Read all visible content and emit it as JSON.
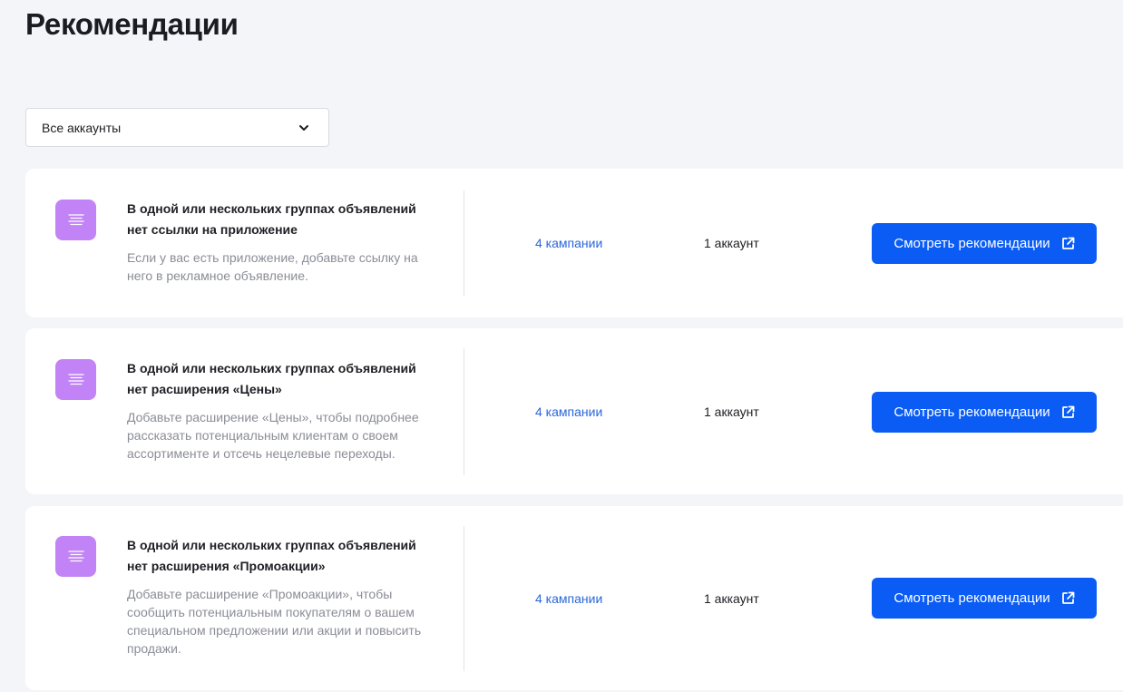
{
  "page": {
    "title": "Рекомендации"
  },
  "filter": {
    "selected": "Все аккаунты"
  },
  "recommendations": [
    {
      "title": "В одной или нескольких группах объявлений нет ссылки на приложение",
      "description": "Если у вас есть приложение, добавьте ссылку на него в рекламное объявление.",
      "campaigns": "4 кампании",
      "accounts": "1 аккаунт",
      "action_label": "Смотреть рекомендации"
    },
    {
      "title": "В одной или нескольких группах объявлений нет расширения «Цены»",
      "description": "Добавьте расширение «Цены», чтобы подробнее рассказать потенциальным клиентам о своем ассортименте и отсечь нецелевые переходы.",
      "campaigns": "4 кампании",
      "accounts": "1 аккаунт",
      "action_label": "Смотреть рекомендации"
    },
    {
      "title": "В одной или нескольких группах объявлений нет расширения «Промоакции»",
      "description": "Добавьте расширение «Промоакции», чтобы сообщить потенциальным покупателям о вашем специальном предложении или акции и повысить продажи.",
      "campaigns": "4 кампании",
      "accounts": "1 аккаунт",
      "action_label": "Смотреть рекомендации"
    }
  ],
  "icons": {
    "card_icon": "text-lines-icon",
    "select_icon": "chevron-down-icon",
    "button_icon": "external-link-icon"
  },
  "colors": {
    "accent": "#0a5cf5",
    "link": "#2a66d8",
    "icon_bg": "#c183f6",
    "background": "#f4f5f9"
  }
}
